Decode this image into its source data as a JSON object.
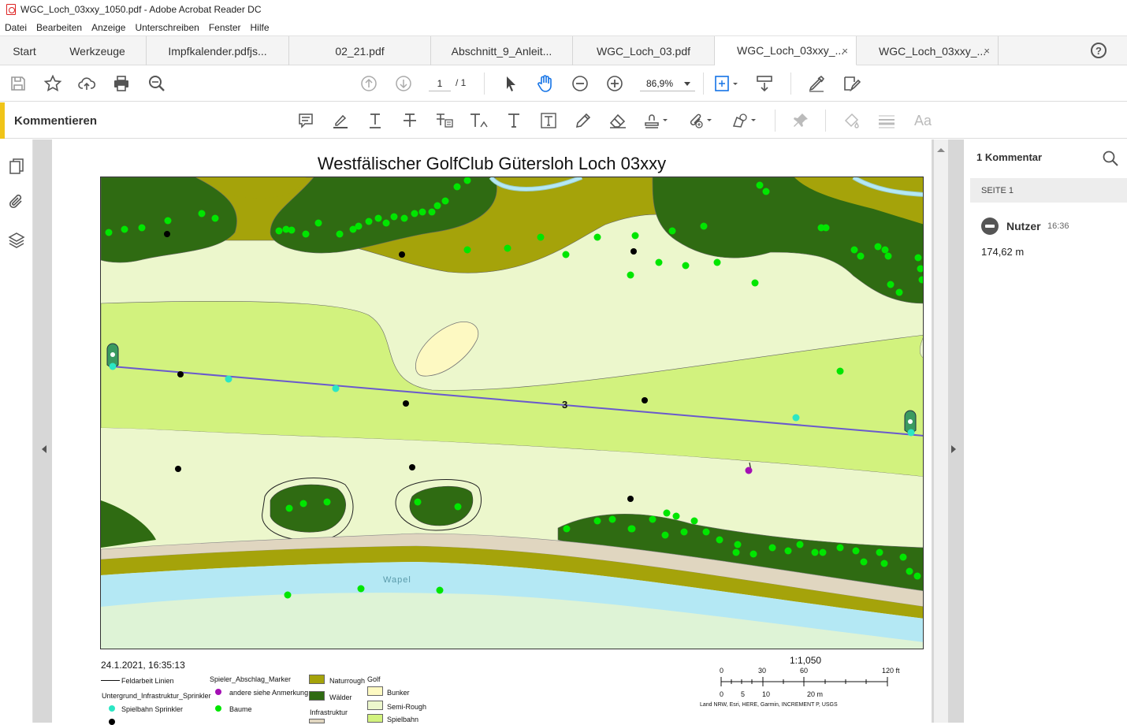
{
  "window": {
    "title": "WGC_Loch_03xxy_1050.pdf - Adobe Acrobat Reader DC"
  },
  "menu": [
    "Datei",
    "Bearbeiten",
    "Anzeige",
    "Unterschreiben",
    "Fenster",
    "Hilfe"
  ],
  "tabs": {
    "start": "Start",
    "tools": "Werkzeuge",
    "docs": [
      "Impfkalender.pdfjs...",
      "02_21.pdf",
      "Abschnitt_9_Anleit...",
      "WGC_Loch_03.pdf",
      "WGC_Loch_03xxy_...",
      "WGC_Loch_03xxy_..."
    ],
    "close": "×",
    "help": "?"
  },
  "toolbar": {
    "page_current": "1",
    "page_total": "/ 1",
    "zoom": "86,9%"
  },
  "comment_bar": {
    "label": "Kommentieren",
    "aa": "Aa"
  },
  "right_panel": {
    "header": "1 Kommentar",
    "section": "SEITE 1",
    "user": "Nutzer",
    "time": "16:36",
    "comment": "174,62 m"
  },
  "map": {
    "title": "Westfälischer GolfClub Gütersloh Loch 03xxy",
    "hole_number": "3",
    "river_label": "Wapel",
    "timestamp": "24.1.2021, 16:35:13",
    "scale_ratio": "1:1,050",
    "scale_ft": [
      "0",
      "30",
      "60",
      "120 ft"
    ],
    "scale_m": [
      "0",
      "5",
      "10",
      "20 m"
    ],
    "attribution": "Land NRW, Esri, HERE, Garmin, INCREMENT P, USGS",
    "legend": {
      "feldarbeit": "Feldarbeit Linien",
      "untergrund": "Untergrund_Infrastruktur_Sprinkler",
      "spielbahn_sprinkler": "Spielbahn Sprinkler",
      "spieler_marker": "Spieler_Abschlag_Marker",
      "andere": "andere siehe Anmerkung",
      "baume": "Baume",
      "naturrough": "Naturrough",
      "walder": "Wälder",
      "infrastruktur": "Infrastruktur",
      "golf": "Golf",
      "bunker": "Bunker",
      "semirough": "Semi-Rough",
      "spielbahn": "Spielbahn"
    },
    "colors": {
      "naturrough": "#a5a30a",
      "forest": "#2f6b12",
      "semirough": "#ecf7cc",
      "fairway": "#d2f27e",
      "bunker": "#fdf9c2",
      "water": "#b4e8f4",
      "tree": "#00e600",
      "sprinkler": "#2ce6c4",
      "marker": "#a40fb4"
    }
  }
}
